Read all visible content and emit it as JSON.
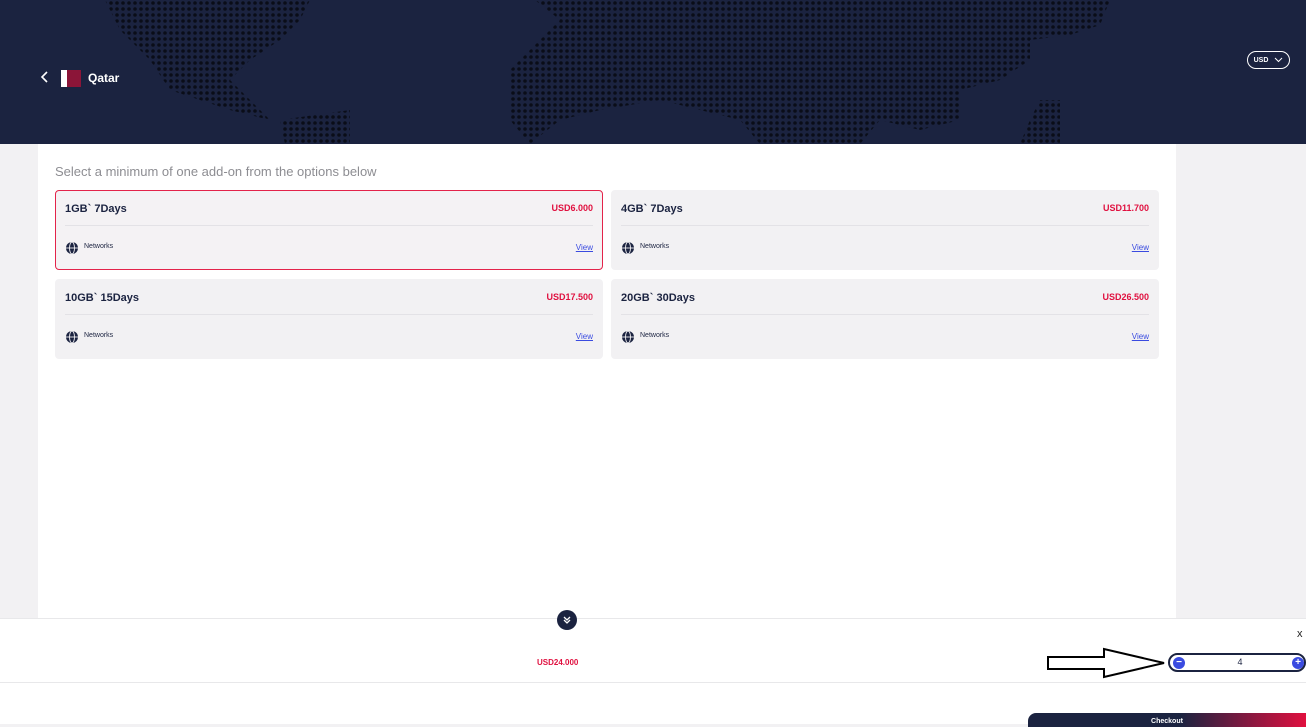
{
  "header": {
    "country": "Qatar",
    "currency": "USD"
  },
  "instruction": "Select a minimum of one add-on from the options below",
  "cards": [
    {
      "name": "1GB` 7Days",
      "price": "USD6.000",
      "networks_label": "Networks",
      "view_label": "View",
      "selected": true
    },
    {
      "name": "4GB` 7Days",
      "price": "USD11.700",
      "networks_label": "Networks",
      "view_label": "View",
      "selected": false
    },
    {
      "name": "10GB` 15Days",
      "price": "USD17.500",
      "networks_label": "Networks",
      "view_label": "View",
      "selected": false
    },
    {
      "name": "20GB` 30Days",
      "price": "USD26.500",
      "networks_label": "Networks",
      "view_label": "View",
      "selected": false
    }
  ],
  "footer": {
    "total": "USD24.000",
    "quantity": "4",
    "close": "x",
    "checkout_label": "Checkout"
  },
  "colors": {
    "navy": "#1b2340",
    "accent_red": "#e0103f",
    "link_blue": "#3a4be0",
    "qatar_maroon": "#8b1538"
  }
}
